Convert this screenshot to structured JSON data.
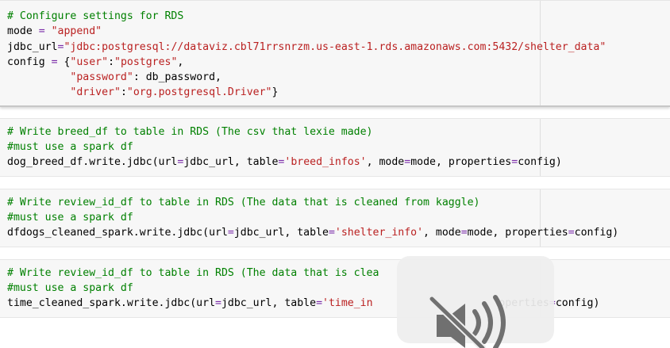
{
  "cells": [
    {
      "lines": [
        [
          {
            "t": "# Configure settings for RDS",
            "k": "comment"
          }
        ],
        [
          {
            "t": "mode "
          },
          {
            "t": "=",
            "k": "op"
          },
          {
            "t": " "
          },
          {
            "t": "\"append\"",
            "k": "str"
          }
        ],
        [
          {
            "t": "jdbc_url"
          },
          {
            "t": "=",
            "k": "op"
          },
          {
            "t": "\"jdbc:postgresql://dataviz.cbl71rrsnrzm.us-east-1.rds.amazonaws.com:5432/shelter_data\"",
            "k": "str"
          }
        ],
        [
          {
            "t": "config "
          },
          {
            "t": "=",
            "k": "op"
          },
          {
            "t": " {"
          },
          {
            "t": "\"user\"",
            "k": "str"
          },
          {
            "t": ":"
          },
          {
            "t": "\"postgres\"",
            "k": "str"
          },
          {
            "t": ","
          }
        ],
        [
          {
            "t": "          "
          },
          {
            "t": "\"password\"",
            "k": "str"
          },
          {
            "t": ": db_password,"
          }
        ],
        [
          {
            "t": "          "
          },
          {
            "t": "\"driver\"",
            "k": "str"
          },
          {
            "t": ":"
          },
          {
            "t": "\"org.postgresql.Driver\"",
            "k": "str"
          },
          {
            "t": "}"
          }
        ]
      ]
    },
    {
      "lines": [
        [
          {
            "t": "# Write breed_df to table in RDS (The csv that lexie made)",
            "k": "comment"
          }
        ],
        [
          {
            "t": "#must use a spark df",
            "k": "comment"
          }
        ],
        [
          {
            "t": "dog_breed_df.write.jdbc(url"
          },
          {
            "t": "=",
            "k": "op"
          },
          {
            "t": "jdbc_url, table"
          },
          {
            "t": "=",
            "k": "op"
          },
          {
            "t": "'breed_infos'",
            "k": "str"
          },
          {
            "t": ", mode"
          },
          {
            "t": "=",
            "k": "op"
          },
          {
            "t": "mode, properties"
          },
          {
            "t": "=",
            "k": "op"
          },
          {
            "t": "config)"
          }
        ]
      ]
    },
    {
      "lines": [
        [
          {
            "t": "# Write review_id_df to table in RDS (The data that is cleaned from kaggle)",
            "k": "comment"
          }
        ],
        [
          {
            "t": "#must use a spark df",
            "k": "comment"
          }
        ],
        [
          {
            "t": "dfdogs_cleaned_spark.write.jdbc(url"
          },
          {
            "t": "=",
            "k": "op"
          },
          {
            "t": "jdbc_url, table"
          },
          {
            "t": "=",
            "k": "op"
          },
          {
            "t": "'shelter_info'",
            "k": "str"
          },
          {
            "t": ", mode"
          },
          {
            "t": "=",
            "k": "op"
          },
          {
            "t": "mode, properties"
          },
          {
            "t": "=",
            "k": "op"
          },
          {
            "t": "config)"
          }
        ]
      ]
    },
    {
      "lines": [
        [
          {
            "t": "# Write review_id_df to table in RDS (The data that is clea",
            "k": "comment"
          }
        ],
        [
          {
            "t": "#must use a spark df",
            "k": "comment"
          }
        ],
        [
          {
            "t": "time_cleaned_spark.write.jdbc(url"
          },
          {
            "t": "=",
            "k": "op"
          },
          {
            "t": "jdbc_url, table"
          },
          {
            "t": "=",
            "k": "op"
          },
          {
            "t": "'time_in",
            "k": "str"
          },
          {
            "t": "                    "
          },
          {
            "t": "operties"
          },
          {
            "t": "=",
            "k": "op"
          },
          {
            "t": "config)"
          }
        ]
      ]
    }
  ],
  "overlay": {
    "icon": "speaker-muted-icon"
  }
}
